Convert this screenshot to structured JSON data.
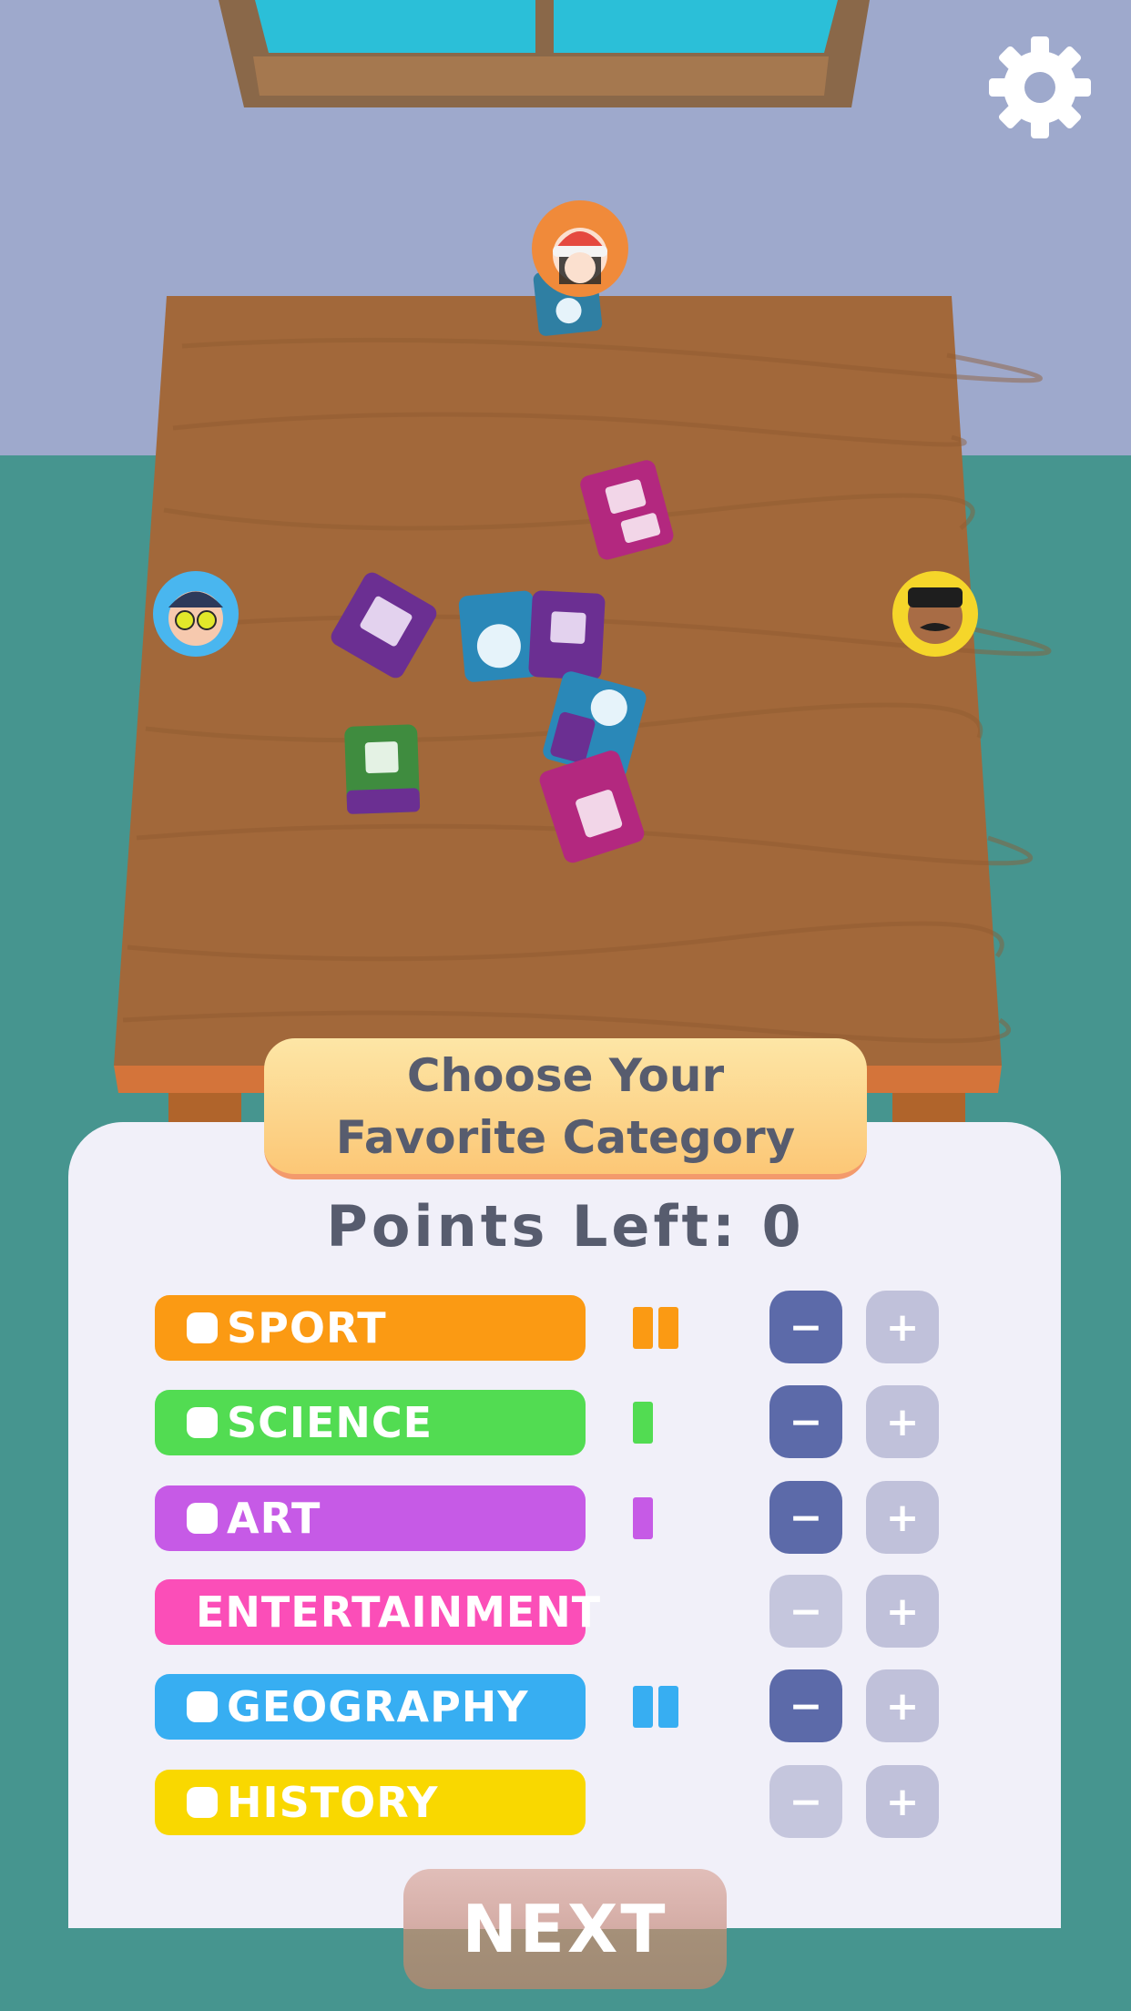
{
  "hud": {
    "settings_icon": "gear-icon"
  },
  "players": [
    {
      "id": "top",
      "icon": "player-avatar-beanie",
      "ring_color": "#f08a3a"
    },
    {
      "id": "left",
      "icon": "player-avatar-glasses",
      "ring_color": "#49b6ef"
    },
    {
      "id": "right",
      "icon": "player-avatar-mustache",
      "ring_color": "#f5d62a"
    }
  ],
  "panel": {
    "title": "Choose Your Favorite Category",
    "points_left": "Points Left: 0"
  },
  "categories": [
    {
      "label": "SPORT",
      "color": "#fb9a13",
      "points": 2,
      "minus_active": true
    },
    {
      "label": "SCIENCE",
      "color": "#52dc52",
      "points": 1,
      "minus_active": true
    },
    {
      "label": "ART",
      "color": "#c65ae6",
      "points": 1,
      "minus_active": true
    },
    {
      "label": "ENTERTAINMENT",
      "color": "#fb4eb8",
      "points": 0,
      "minus_active": false
    },
    {
      "label": "GEOGRAPHY",
      "color": "#37aef2",
      "points": 2,
      "minus_active": true
    },
    {
      "label": "HISTORY",
      "color": "#f9d800",
      "points": 0,
      "minus_active": false
    }
  ],
  "controls": {
    "minus_symbol": "−",
    "plus_symbol": "+"
  },
  "next_button": {
    "label": "NEXT"
  },
  "dice_faces": [
    "book-icon",
    "globe-icon",
    "play-icon",
    "flask-icon"
  ]
}
